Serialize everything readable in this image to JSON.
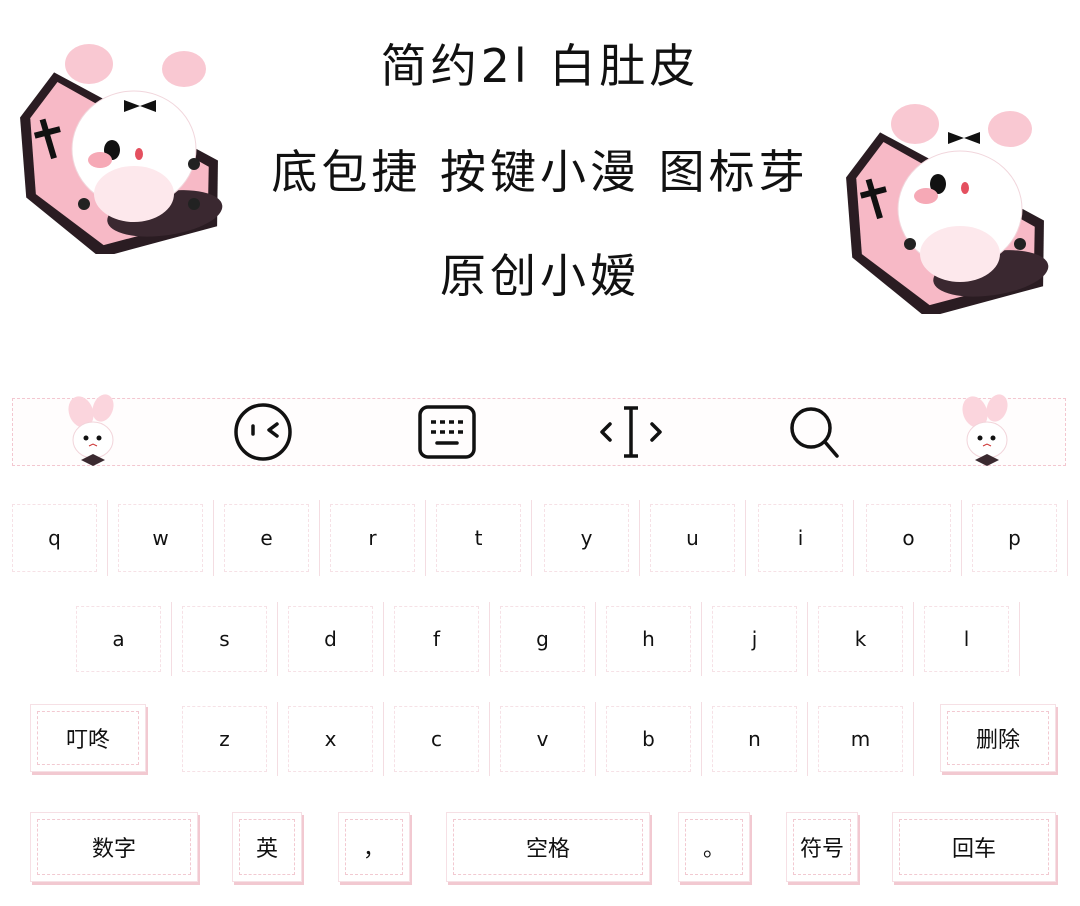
{
  "header": {
    "line1": "简约2l 白肚皮",
    "line2": "底包捷 按键小漫 图标芽",
    "line3": "原创小嫒"
  },
  "toolbar": {
    "icons": [
      "bunny-sticker-icon",
      "emoji-face-icon",
      "keyboard-icon",
      "cursor-move-icon",
      "search-icon",
      "bunny-sticker-icon"
    ]
  },
  "keyboard": {
    "row1": [
      "q",
      "w",
      "e",
      "r",
      "t",
      "y",
      "u",
      "i",
      "o",
      "p"
    ],
    "row2": [
      "a",
      "s",
      "d",
      "f",
      "g",
      "h",
      "j",
      "k",
      "l"
    ],
    "row3_letters": [
      "z",
      "x",
      "c",
      "v",
      "b",
      "n",
      "m"
    ],
    "dingdong": "叮咚",
    "delete": "删除",
    "numbers": "数字",
    "english": "英",
    "comma": "，",
    "space": "空格",
    "period": "。",
    "symbols": "符号",
    "enter": "回车"
  },
  "colors": {
    "accent_pink": "#f4b8c4",
    "dark": "#2a1c22",
    "background": "#ffffff"
  }
}
